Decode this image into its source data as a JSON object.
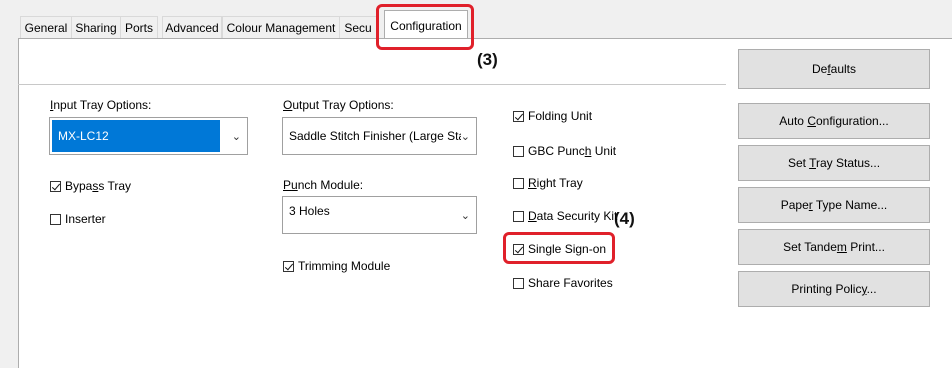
{
  "tabs": [
    {
      "label": "General"
    },
    {
      "label": "Sharing"
    },
    {
      "label": "Ports"
    },
    {
      "label": "Advanced"
    },
    {
      "label": "Colour Management"
    },
    {
      "label": "Secu"
    },
    {
      "label": "Configuration"
    }
  ],
  "callouts": {
    "step3": "(3)",
    "step4": "(4)"
  },
  "input_tray": {
    "label_pre": "I",
    "label_rest": "nput Tray Options:",
    "value": "MX-LC12",
    "bypass_pre": "Bypa",
    "bypass_u": "s",
    "bypass_post": "s Tray",
    "inserter": "Inserter"
  },
  "output_tray": {
    "label_pre": "O",
    "label_rest": "utput Tray Options:",
    "value": "Saddle Stitch Finisher (Large Stack"
  },
  "punch": {
    "label_pre": "P",
    "label_u": "u",
    "label_rest": "nch Module:",
    "value": "3 Holes"
  },
  "trimming": "Trimming Module",
  "options": {
    "folding": "Folding Unit",
    "gbc_pre": "GBC Punc",
    "gbc_u": "h",
    "gbc_post": " Unit",
    "right_u": "R",
    "right_post": "ight Tray",
    "data_u": "D",
    "data_post": "ata Security Kit",
    "sso": "Single Sign-on",
    "share": "Share Favorites"
  },
  "buttons": {
    "defaults_pre": "De",
    "defaults_u": "f",
    "defaults_post": "aults",
    "auto_pre": "Auto ",
    "auto_u": "C",
    "auto_post": "onfiguration...",
    "tray_pre": "Set ",
    "tray_u": "T",
    "tray_post": "ray Status...",
    "paper_pre": "Pape",
    "paper_u": "r",
    "paper_post": " Type Name...",
    "tandem_pre": "Set Tande",
    "tandem_u": "m",
    "tandem_post": " Print...",
    "policy_pre": "Printing Polic",
    "policy_u": "y",
    "policy_post": "..."
  },
  "checked": {
    "bypass": true,
    "inserter": false,
    "trimming": true,
    "folding": true,
    "gbc": false,
    "right": false,
    "data": false,
    "sso": true,
    "share": false
  },
  "colors": {
    "highlight": "#e0202a",
    "selection": "#0078d7"
  }
}
